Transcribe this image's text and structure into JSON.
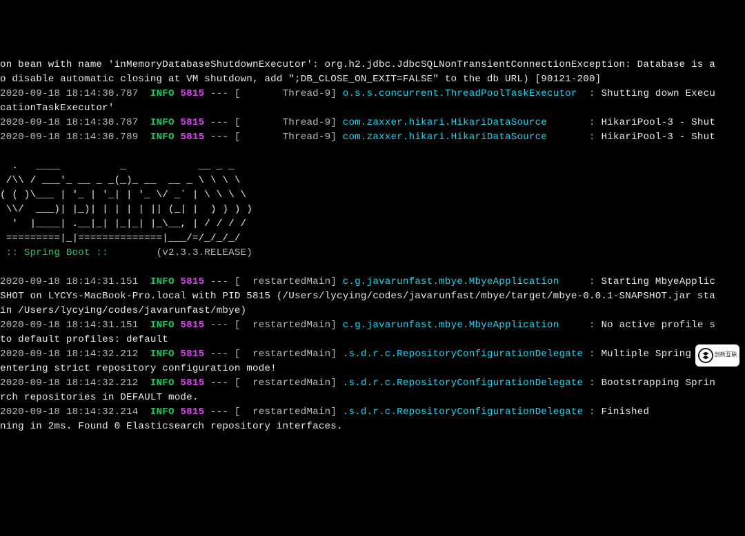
{
  "top": {
    "line1": "on bean with name 'inMemoryDatabaseShutdownExecutor': org.h2.jdbc.JdbcSQLNonTransientConnectionException: Database is a",
    "line2": "o disable automatic closing at VM shutdown, add \";DB_CLOSE_ON_EXIT=FALSE\" to the db URL) [90121-200]"
  },
  "logs1": [
    {
      "ts": "2020-09-18 18:14:30.787",
      "lvl": "INFO",
      "pid": "5815",
      "thr": "       Thread-9",
      "logger": "o.s.s.concurrent.ThreadPoolTaskExecutor ",
      "msg": "Shutting down Execu",
      "cont": "cationTaskExecutor'"
    },
    {
      "ts": "2020-09-18 18:14:30.787",
      "lvl": "INFO",
      "pid": "5815",
      "thr": "       Thread-9",
      "logger": "com.zaxxer.hikari.HikariDataSource      ",
      "msg": "HikariPool-3 - Shut"
    },
    {
      "ts": "2020-09-18 18:14:30.789",
      "lvl": "INFO",
      "pid": "5815",
      "thr": "       Thread-9",
      "logger": "com.zaxxer.hikari.HikariDataSource      ",
      "msg": "HikariPool-3 - Shut"
    }
  ],
  "ascii": [
    "  .   ____          _            __ _ _",
    " /\\\\ / ___'_ __ _ _(_)_ __  __ _ \\ \\ \\ \\",
    "( ( )\\___ | '_ | '_| | '_ \\/ _` | \\ \\ \\ \\",
    " \\\\/  ___)| |_)| | | | | || (_| |  ) ) ) )",
    "  '  |____| .__|_| |_|_| |_\\__, | / / / /",
    " =========|_|==============|___/=/_/_/_/"
  ],
  "banner": {
    "label": " :: Spring Boot :: ",
    "version": "       (v2.3.3.RELEASE)"
  },
  "logs2": [
    {
      "ts": "2020-09-18 18:14:31.151",
      "lvl": "INFO",
      "pid": "5815",
      "thr": "  restartedMain",
      "logger": "c.g.javarunfast.mbye.MbyeApplication    ",
      "msg": "Starting MbyeApplic",
      "cont": [
        "SHOT on LYCYs-MacBook-Pro.local with PID 5815 (/Users/lycying/codes/javarunfast/mbye/target/mbye-0.0.1-SNAPSHOT.jar sta",
        "in /Users/lycying/codes/javarunfast/mbye)"
      ]
    },
    {
      "ts": "2020-09-18 18:14:31.151",
      "lvl": "INFO",
      "pid": "5815",
      "thr": "  restartedMain",
      "logger": "c.g.javarunfast.mbye.MbyeApplication    ",
      "msg": "No active profile s",
      "cont": [
        "to default profiles: default"
      ]
    },
    {
      "ts": "2020-09-18 18:14:32.212",
      "lvl": "INFO",
      "pid": "5815",
      "thr": "  restartedMain",
      "logger": ".s.d.r.c.RepositoryConfigurationDelegate",
      "msg": "Multiple Spring Dat",
      "cont": [
        "entering strict repository configuration mode!"
      ]
    },
    {
      "ts": "2020-09-18 18:14:32.212",
      "lvl": "INFO",
      "pid": "5815",
      "thr": "  restartedMain",
      "logger": ".s.d.r.c.RepositoryConfigurationDelegate",
      "msg": "Bootstrapping Sprin",
      "cont": [
        "rch repositories in DEFAULT mode."
      ]
    },
    {
      "ts": "2020-09-18 18:14:32.214",
      "lvl": "INFO",
      "pid": "5815",
      "thr": "  restartedMain",
      "logger": ".s.d.r.c.RepositoryConfigurationDelegate",
      "msg": "Finished",
      "cont": [
        "ning in 2ms. Found 0 Elasticsearch repository interfaces."
      ]
    }
  ],
  "watermark": "创新互联"
}
